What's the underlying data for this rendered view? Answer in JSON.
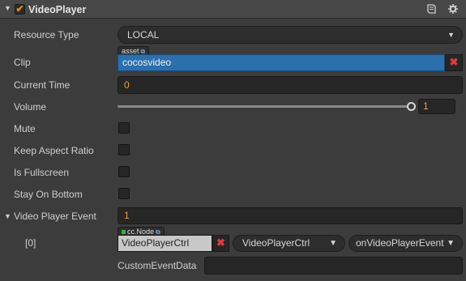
{
  "component": {
    "title": "VideoPlayer",
    "enabled": true,
    "collapse_glyph": "▼",
    "check_glyph": "✔",
    "icons": [
      "book-icon",
      "gear-icon"
    ]
  },
  "properties": {
    "resource_type": {
      "label": "Resource Type",
      "value": "LOCAL",
      "arrow": "▼"
    },
    "clip": {
      "label": "Clip",
      "tag": "asset",
      "value": "cocosvideo",
      "clear": "✖"
    },
    "current_time": {
      "label": "Current Time",
      "value": "0"
    },
    "volume": {
      "label": "Volume",
      "value": "1",
      "level": 1.0
    },
    "mute": {
      "label": "Mute",
      "checked": false
    },
    "keep_aspect_ratio": {
      "label": "Keep Aspect Ratio",
      "checked": false
    },
    "is_fullscreen": {
      "label": "Is Fullscreen",
      "checked": false
    },
    "stay_on_bottom": {
      "label": "Stay On Bottom",
      "checked": false
    }
  },
  "video_player_event": {
    "label": "Video Player Event",
    "arrow": "▼",
    "count": "1",
    "item": {
      "index": "[0]",
      "tag": "cc.Node",
      "target": "VideoPlayerCtrl",
      "clear": "✖",
      "component": "VideoPlayerCtrl",
      "handler": "onVideoPlayerEvent",
      "custom_label": "CustomEventData",
      "custom_value": ""
    }
  },
  "colors": {
    "panel_bg": "#3c3c3c",
    "accent_orange": "#f09a3c",
    "asset_blue": "#2c6fad",
    "clear_red": "#e03b3b"
  }
}
